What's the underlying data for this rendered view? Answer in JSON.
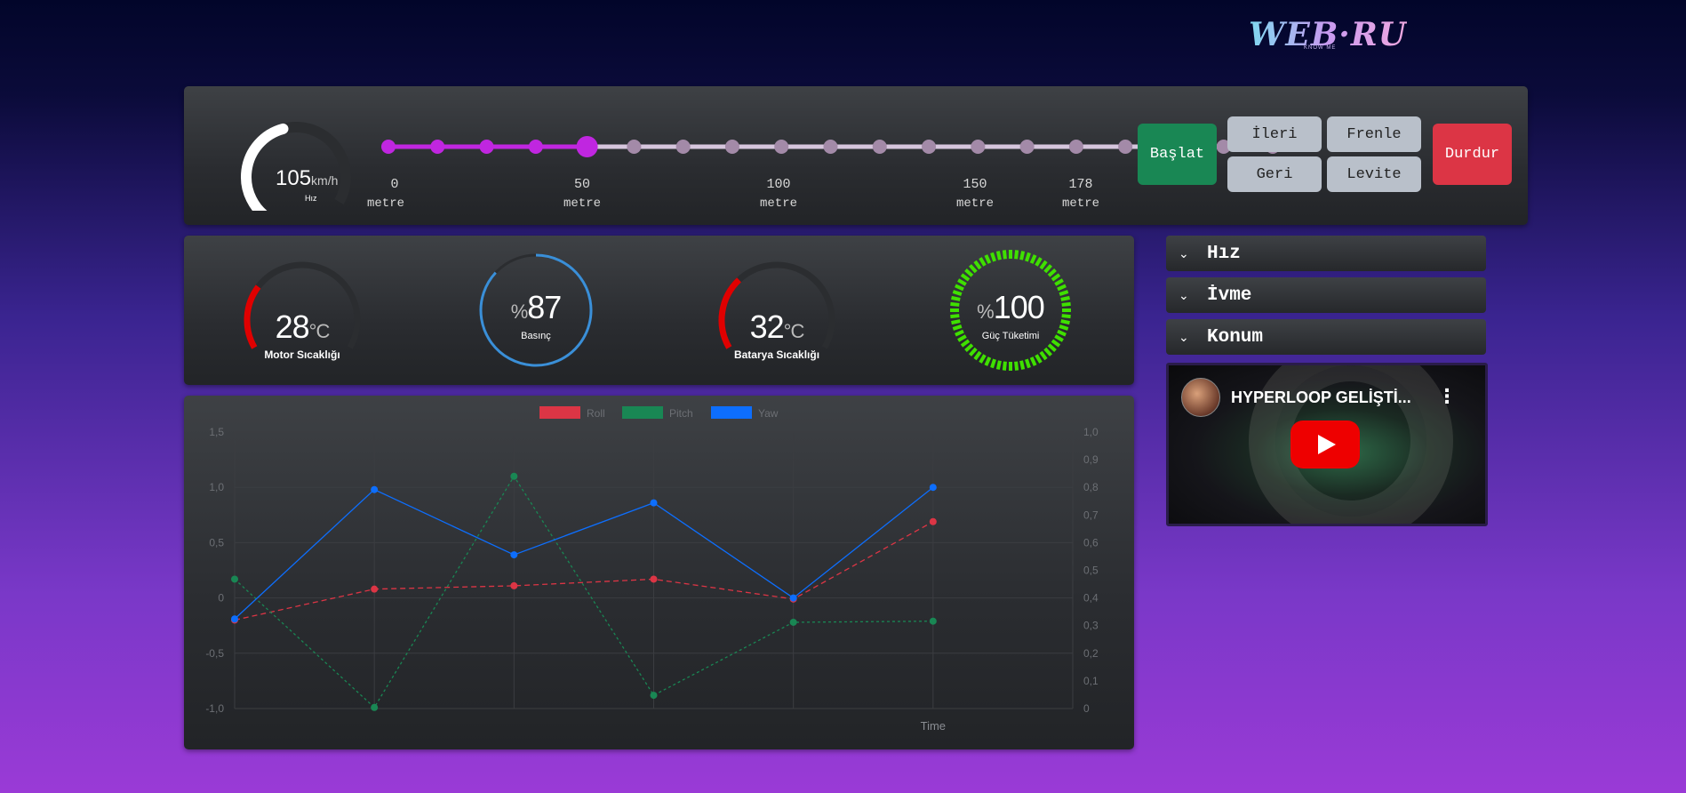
{
  "logo": {
    "text": "WEB·RU",
    "sub": "KNOW ME"
  },
  "speed": {
    "value": "105",
    "unit": "km/h",
    "label": "Hız",
    "fraction": 0.5
  },
  "track": {
    "position_fraction": 0.2247,
    "ticks": [
      {
        "value": "0",
        "unit": "metre"
      },
      {
        "value": "50",
        "unit": "metre"
      },
      {
        "value": "100",
        "unit": "metre"
      },
      {
        "value": "150",
        "unit": "metre"
      },
      {
        "value": "178",
        "unit": "metre"
      }
    ],
    "colors": {
      "active": "#c026e0",
      "inactive": "#a38aa8",
      "line_inactive": "#d6c6dd"
    }
  },
  "controls": {
    "start": "Başlat",
    "forward": "İleri",
    "brake": "Frenle",
    "back": "Geri",
    "levitate": "Levite",
    "stop": "Durdur"
  },
  "gauges": {
    "motor_temp": {
      "value": "28",
      "unit": "°C",
      "label": "Motor Sıcaklığı",
      "fraction": 0.28,
      "color": "#e00000"
    },
    "pressure": {
      "prefix": "%",
      "value": "87",
      "label": "Basınç",
      "fraction": 0.87,
      "color": "#3a8fd8"
    },
    "battery_temp": {
      "value": "32",
      "unit": "°C",
      "label": "Batarya Sıcaklığı",
      "fraction": 0.32,
      "color": "#e00000"
    },
    "power": {
      "prefix": "%",
      "value": "100",
      "label": "Güç Tüketimi",
      "fraction": 1.0,
      "color": "#3fe000"
    }
  },
  "accordion": [
    {
      "title": "Hız"
    },
    {
      "title": "İvme"
    },
    {
      "title": "Konum"
    }
  ],
  "video": {
    "title": "HYPERLOOP GELİŞTİ..."
  },
  "chart_data": {
    "type": "line",
    "x": [
      "",
      "",
      "",
      "",
      "",
      ""
    ],
    "xlabel": "Time",
    "ylim": [
      -1.0,
      1.5
    ],
    "y_ticks": [
      "1,5",
      "1,0",
      "0,5",
      "0",
      "-0,5",
      "-1,0"
    ],
    "y2lim": [
      0,
      1.0
    ],
    "y2_ticks": [
      "1,0",
      "0,9",
      "0,8",
      "0,7",
      "0,6",
      "0,5",
      "0,4",
      "0,3",
      "0,2",
      "0,1",
      "0"
    ],
    "legend_position": "top",
    "series": [
      {
        "name": "Roll",
        "color": "#dc3545",
        "dash": true,
        "values": [
          -0.2,
          0.08,
          0.11,
          0.17,
          -0.01,
          0.69
        ]
      },
      {
        "name": "Pitch",
        "color": "#198754",
        "dash": true,
        "values": [
          0.17,
          -0.99,
          1.1,
          -0.88,
          -0.22,
          -0.21
        ]
      },
      {
        "name": "Yaw",
        "color": "#0d6efd",
        "dash": false,
        "values": [
          -0.19,
          0.98,
          0.39,
          0.86,
          0.0,
          1.0
        ]
      }
    ]
  }
}
